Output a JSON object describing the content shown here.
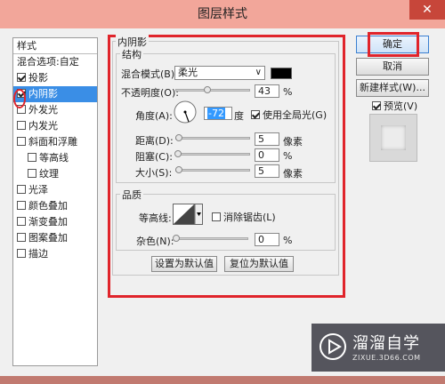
{
  "window": {
    "title": "图层样式",
    "close_glyph": "✕"
  },
  "left_panel": {
    "header": "样式",
    "items": [
      {
        "label": "混合选项:自定",
        "checkbox": false,
        "checked": false,
        "indent": false,
        "selected": false
      },
      {
        "label": "投影",
        "checkbox": true,
        "checked": true,
        "indent": false,
        "selected": false
      },
      {
        "label": "内阴影",
        "checkbox": true,
        "checked": true,
        "indent": false,
        "selected": true
      },
      {
        "label": "外发光",
        "checkbox": true,
        "checked": false,
        "indent": false,
        "selected": false
      },
      {
        "label": "内发光",
        "checkbox": true,
        "checked": false,
        "indent": false,
        "selected": false
      },
      {
        "label": "斜面和浮雕",
        "checkbox": true,
        "checked": false,
        "indent": false,
        "selected": false
      },
      {
        "label": "等高线",
        "checkbox": true,
        "checked": false,
        "indent": true,
        "selected": false
      },
      {
        "label": "纹理",
        "checkbox": true,
        "checked": false,
        "indent": true,
        "selected": false
      },
      {
        "label": "光泽",
        "checkbox": true,
        "checked": false,
        "indent": false,
        "selected": false
      },
      {
        "label": "颜色叠加",
        "checkbox": true,
        "checked": false,
        "indent": false,
        "selected": false
      },
      {
        "label": "渐变叠加",
        "checkbox": true,
        "checked": false,
        "indent": false,
        "selected": false
      },
      {
        "label": "图案叠加",
        "checkbox": true,
        "checked": false,
        "indent": false,
        "selected": false
      },
      {
        "label": "描边",
        "checkbox": true,
        "checked": false,
        "indent": false,
        "selected": false
      }
    ]
  },
  "inner_shadow": {
    "section_title": "内阴影",
    "structure": {
      "title": "结构",
      "blend_mode_label": "混合模式(B):",
      "blend_mode_value": "柔光",
      "shadow_color": "#000000",
      "opacity_label": "不透明度(O):",
      "opacity_value": "43",
      "opacity_fraction": 0.43,
      "opacity_unit": "%",
      "angle_label": "角度(A):",
      "angle_value": "-72",
      "angle_unit": "度",
      "global_light_label": "使用全局光(G)",
      "global_light_checked": true,
      "distance_label": "距离(D):",
      "distance_value": "5",
      "distance_unit": "像素",
      "choke_label": "阻塞(C):",
      "choke_value": "0",
      "choke_unit": "%",
      "size_label": "大小(S):",
      "size_value": "5",
      "size_unit": "像素"
    },
    "quality": {
      "title": "品质",
      "contour_label": "等高线:",
      "antialias_label": "消除锯齿(L)",
      "antialias_checked": false,
      "noise_label": "杂色(N):",
      "noise_value": "0",
      "noise_unit": "%"
    },
    "buttons": {
      "make_default": "设置为默认值",
      "reset_default": "复位为默认值"
    }
  },
  "right_panel": {
    "ok": "确定",
    "cancel": "取消",
    "new_style": "新建样式(W)...",
    "preview_label": "预览(V)",
    "preview_checked": true
  },
  "watermark": {
    "brand": "溜溜自学",
    "url": "ZIXUE.3D66.COM"
  },
  "colors": {
    "highlight_red": "#e0242b",
    "selection_blue": "#3a8ee6",
    "titlebar": "#f2a69a"
  }
}
